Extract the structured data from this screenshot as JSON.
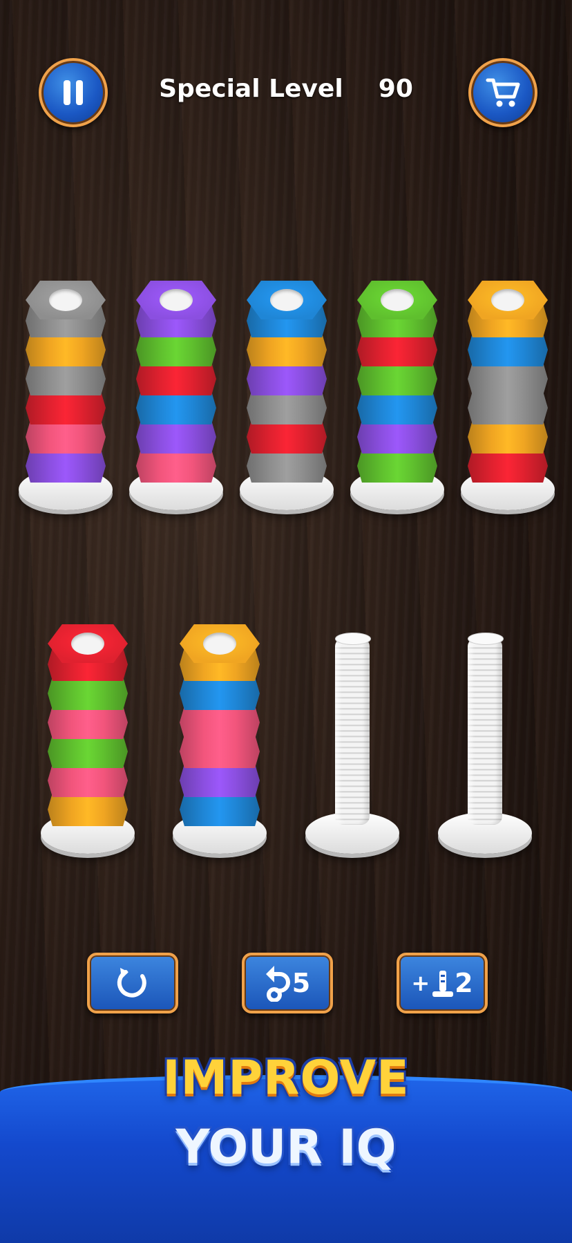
{
  "header": {
    "title_label": "Special Level",
    "level_number": "90",
    "pause_icon": "pause-icon",
    "shop_icon": "shopping-cart-icon"
  },
  "board": {
    "top_row": [
      [
        "gray",
        "orange",
        "gray",
        "red",
        "pink",
        "purple"
      ],
      [
        "purple",
        "green",
        "red",
        "blue",
        "purple",
        "pink"
      ],
      [
        "blue",
        "orange",
        "purple",
        "gray",
        "red",
        "gray"
      ],
      [
        "green",
        "red",
        "green",
        "blue",
        "purple",
        "green"
      ],
      [
        "orange",
        "blue",
        "gray",
        "gray",
        "orange",
        "red"
      ]
    ],
    "bottom_row": [
      [
        "red",
        "green",
        "pink",
        "green",
        "pink",
        "orange"
      ],
      [
        "orange",
        "blue",
        "pink",
        "pink",
        "purple",
        "blue"
      ],
      [],
      []
    ]
  },
  "colors": {
    "gray": "#8e8e8e",
    "orange": "#f0a522",
    "red": "#e0212f",
    "pink": "#f2557c",
    "purple": "#8b4fe0",
    "green": "#5fbf2e",
    "blue": "#1f86d6",
    "button_blue": "#1b55b8",
    "button_border": "#f0a24a"
  },
  "toolbar": {
    "restart_icon": "restart-icon",
    "undo_icon": "undo-icon",
    "undo_count": "5",
    "add_peg_icon": "add-peg-icon",
    "add_peg_plus": "+",
    "add_peg_count": "2"
  },
  "promo": {
    "line1": "IMPROVE",
    "line2": "YOUR IQ"
  }
}
